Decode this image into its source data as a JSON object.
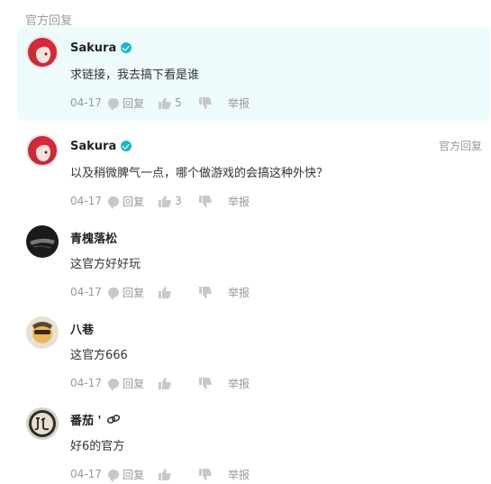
{
  "section_label": "官方回复",
  "comments": [
    {
      "name": "Sakura",
      "verified": true,
      "text": "求链接，我去搞下看是谁",
      "date": "04-17",
      "reply_label": "回复",
      "likes": "5",
      "report_label": "举报",
      "tag": ""
    },
    {
      "name": "Sakura",
      "verified": true,
      "text": "以及稍微脾气一点，哪个做游戏的会搞这种外快？",
      "date": "04-17",
      "reply_label": "回复",
      "likes": "3",
      "report_label": "举报",
      "tag": "官方回复"
    },
    {
      "name": "青槐落松",
      "verified": false,
      "text": "这官方好好玩",
      "date": "04-17",
      "reply_label": "回复",
      "likes": "",
      "report_label": "举报",
      "tag": ""
    },
    {
      "name": "八巷",
      "verified": false,
      "text": "这官方666",
      "date": "04-17",
      "reply_label": "回复",
      "likes": "",
      "report_label": "举报",
      "tag": ""
    },
    {
      "name": "番茄 '",
      "verified": false,
      "text": "好6的官方",
      "date": "04-17",
      "reply_label": "回复",
      "likes": "",
      "report_label": "举报",
      "tag": ""
    }
  ],
  "colors": {
    "official_bg": "#eefbfd",
    "verified": "#1bb7c9",
    "meta": "#999999"
  },
  "icons": [
    "reply-icon",
    "thumbs-up-icon",
    "thumbs-down-icon",
    "verified-icon",
    "link-badge-icon"
  ]
}
